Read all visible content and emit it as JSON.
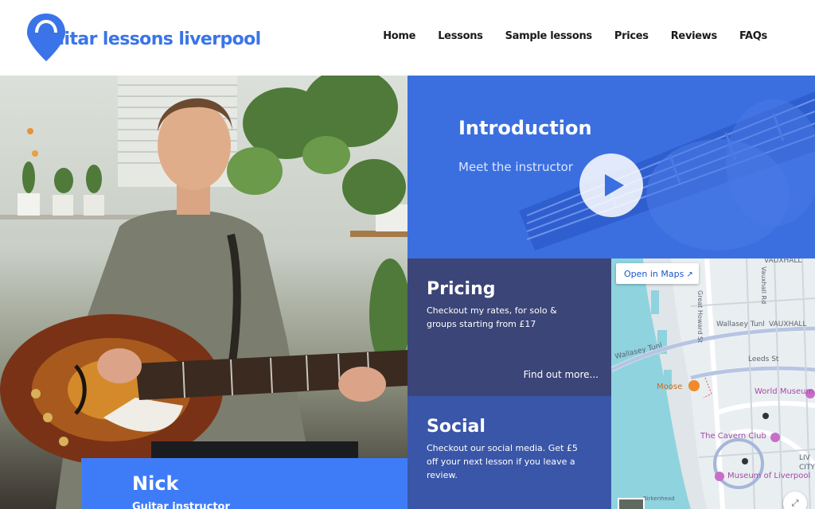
{
  "header": {
    "brand": "Guitar lessons liverpool",
    "nav": [
      "Home",
      "Lessons",
      "Sample lessons",
      "Prices",
      "Reviews",
      "FAQs"
    ]
  },
  "hero": {
    "name": "Nick",
    "role": "Guitar instructor"
  },
  "intro": {
    "title": "Introduction",
    "subtitle": "Meet the instructor"
  },
  "pricing": {
    "title": "Pricing",
    "body": "Checkout my rates, for solo & groups starting from £17",
    "link": "Find out more..."
  },
  "social": {
    "title": "Social",
    "body": "Checkout our social media. Get £5 off your next lesson if you leave a review."
  },
  "map": {
    "open_button": "Open in Maps",
    "labels": {
      "vauxhall_top": "VAUXHALL",
      "great_howard": "Great Howard St",
      "vauxhall_rd": "Vauxhall Rd",
      "wallasey_tunl_1": "Wallasey Tunl",
      "vauxhall_mid": "VAUXHALL",
      "wallasey_tunl_2": "Wallasey Tunl",
      "leeds_st": "Leeds St",
      "birkenhead": "Birkenhead",
      "liv": "LIV",
      "city": "CITY"
    },
    "pois": {
      "moose": "Moose",
      "world_museum": "World Museum",
      "cavern": "The Cavern Club",
      "museum_liverpool": "Museum of Liverpool"
    }
  },
  "colors": {
    "brand_blue": "#3a74e8",
    "intro_bg": "#3b6fe0",
    "pricing_bg": "#3b4577",
    "social_bg": "#3a56a8",
    "name_card_bg": "#3e7cf7"
  },
  "icons": {
    "logo": "map-pin-icon",
    "play": "play-icon",
    "external": "external-link-icon",
    "fullscreen": "fullscreen-icon"
  }
}
